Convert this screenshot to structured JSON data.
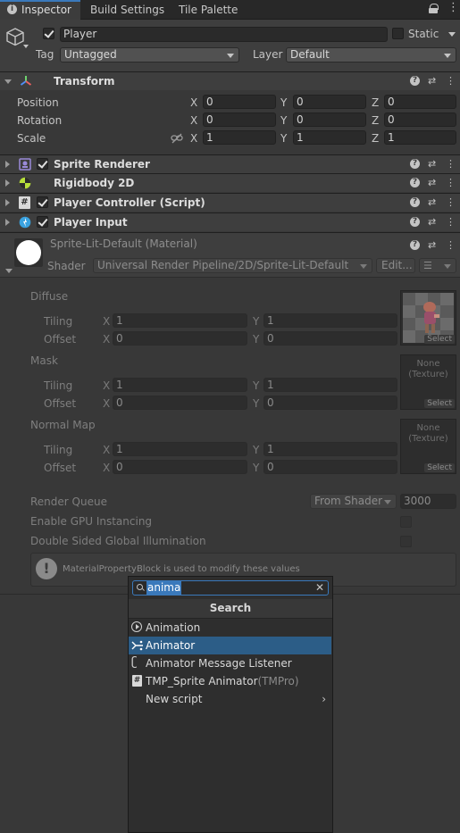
{
  "tabs": [
    {
      "label": "Inspector"
    },
    {
      "label": "Build Settings"
    },
    {
      "label": "Tile Palette"
    }
  ],
  "object": {
    "name": "Player",
    "static_label": "Static",
    "tag_label": "Tag",
    "tag_value": "Untagged",
    "layer_label": "Layer",
    "layer_value": "Default"
  },
  "transform": {
    "title": "Transform",
    "rows": [
      {
        "label": "Position",
        "x": "0",
        "y": "0",
        "z": "0"
      },
      {
        "label": "Rotation",
        "x": "0",
        "y": "0",
        "z": "0"
      },
      {
        "label": "Scale",
        "x": "1",
        "y": "1",
        "z": "1"
      }
    ],
    "axis_x": "X",
    "axis_y": "Y",
    "axis_z": "Z"
  },
  "components": [
    {
      "title": "Sprite Renderer"
    },
    {
      "title": "Rigidbody 2D"
    },
    {
      "title": "Player Controller (Script)"
    },
    {
      "title": "Player Input"
    }
  ],
  "material": {
    "name": "Sprite-Lit-Default (Material)",
    "shader_label": "Shader",
    "shader_value": "Universal Render Pipeline/2D/Sprite-Lit-Default",
    "edit_label": "Edit...",
    "sections": [
      {
        "label": "Diffuse",
        "tex_none": "",
        "tex_type": ""
      },
      {
        "label": "Mask",
        "tex_none": "None",
        "tex_type": "(Texture)"
      },
      {
        "label": "Normal Map",
        "tex_none": "None",
        "tex_type": "(Texture)"
      }
    ],
    "tiling_label": "Tiling",
    "offset_label": "Offset",
    "tiling_x": "1",
    "tiling_y": "1",
    "offset_x": "0",
    "offset_y": "0",
    "select_label": "Select",
    "render_queue_label": "Render Queue",
    "render_queue_mode": "From Shader",
    "render_queue_value": "3000",
    "gpu_instancing_label": "Enable GPU Instancing",
    "double_sided_gi_label": "Double Sided Global Illumination",
    "info_text": "MaterialPropertyBlock is used to modify these values"
  },
  "popup": {
    "search_value": "anima",
    "heading": "Search",
    "items": [
      {
        "label": "Animation",
        "suffix": ""
      },
      {
        "label": "Animator",
        "suffix": ""
      },
      {
        "label": "Animator Message Listener",
        "suffix": ""
      },
      {
        "label": "TMP_Sprite Animator",
        "suffix": "(TMPro)"
      },
      {
        "label": "New script",
        "suffix": ""
      }
    ]
  },
  "colors": {
    "panel_bg": "#383838",
    "header_bg": "#3e3e3e",
    "selection": "#2c5d87",
    "tab_active_bg": "#3c3c3c"
  }
}
